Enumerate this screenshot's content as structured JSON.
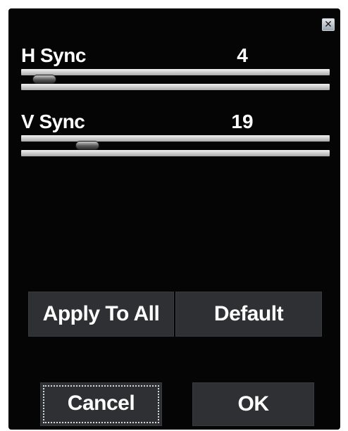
{
  "dialog": {
    "close_icon": "close-icon",
    "close_glyph": "✕"
  },
  "h_sync": {
    "label": "H Sync",
    "value": "4",
    "min": 0,
    "max": 100
  },
  "v_sync": {
    "label": "V Sync",
    "value": "19",
    "min": 0,
    "max": 100
  },
  "buttons": {
    "apply_to_all": "Apply To All",
    "default": "Default",
    "cancel": "Cancel",
    "ok": "OK"
  },
  "colors": {
    "dialog_background": "#050505",
    "button_background": "#2f3033",
    "text": "#ffffff"
  }
}
